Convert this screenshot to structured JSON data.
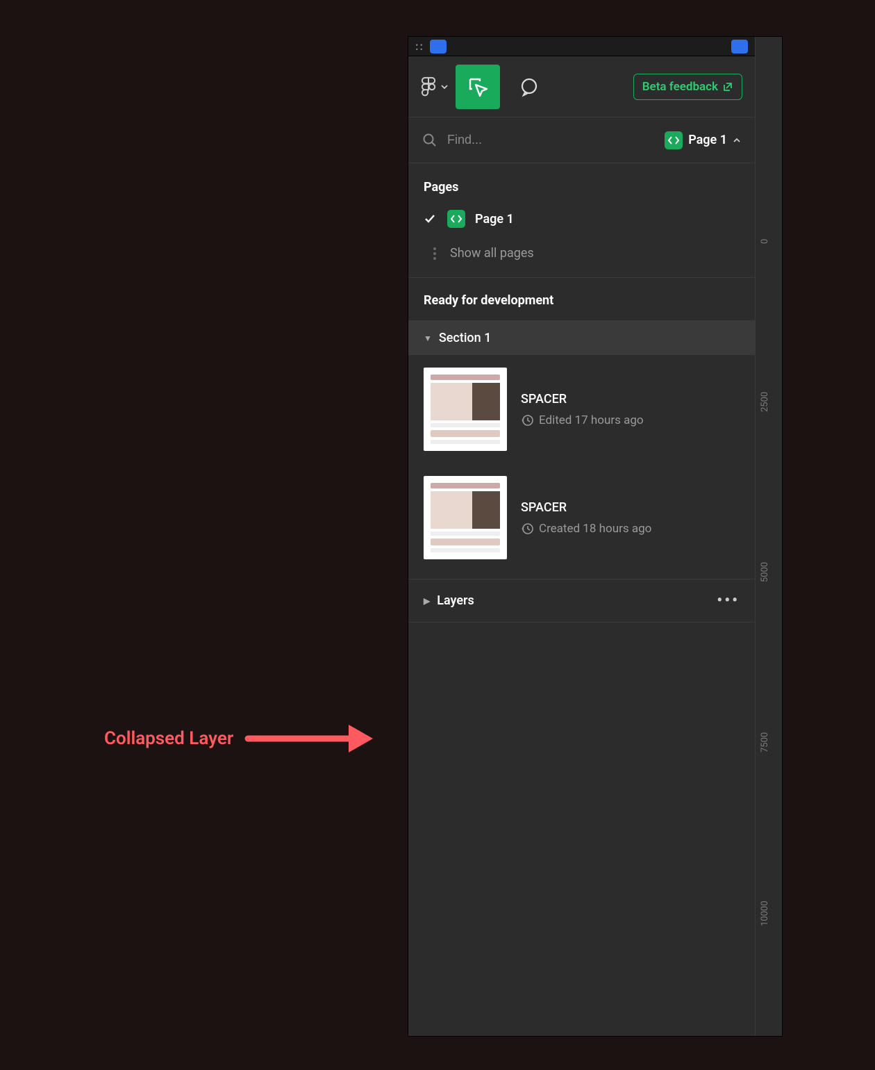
{
  "toolbar": {
    "beta_label": "Beta feedback"
  },
  "search": {
    "placeholder": "Find...",
    "page_chip": "Page 1"
  },
  "pages": {
    "header": "Pages",
    "current": "Page 1",
    "show_all": "Show all pages"
  },
  "ready": {
    "header": "Ready for development",
    "section": "Section 1",
    "items": [
      {
        "name": "SPACER",
        "meta": "Edited 17 hours ago"
      },
      {
        "name": "SPACER",
        "meta": "Created 18 hours ago"
      }
    ]
  },
  "layers": {
    "label": "Layers"
  },
  "ruler": {
    "ticks": [
      "0",
      "2500",
      "5000",
      "7500",
      "10000"
    ]
  },
  "annotation": {
    "label": "Collapsed Layer"
  }
}
